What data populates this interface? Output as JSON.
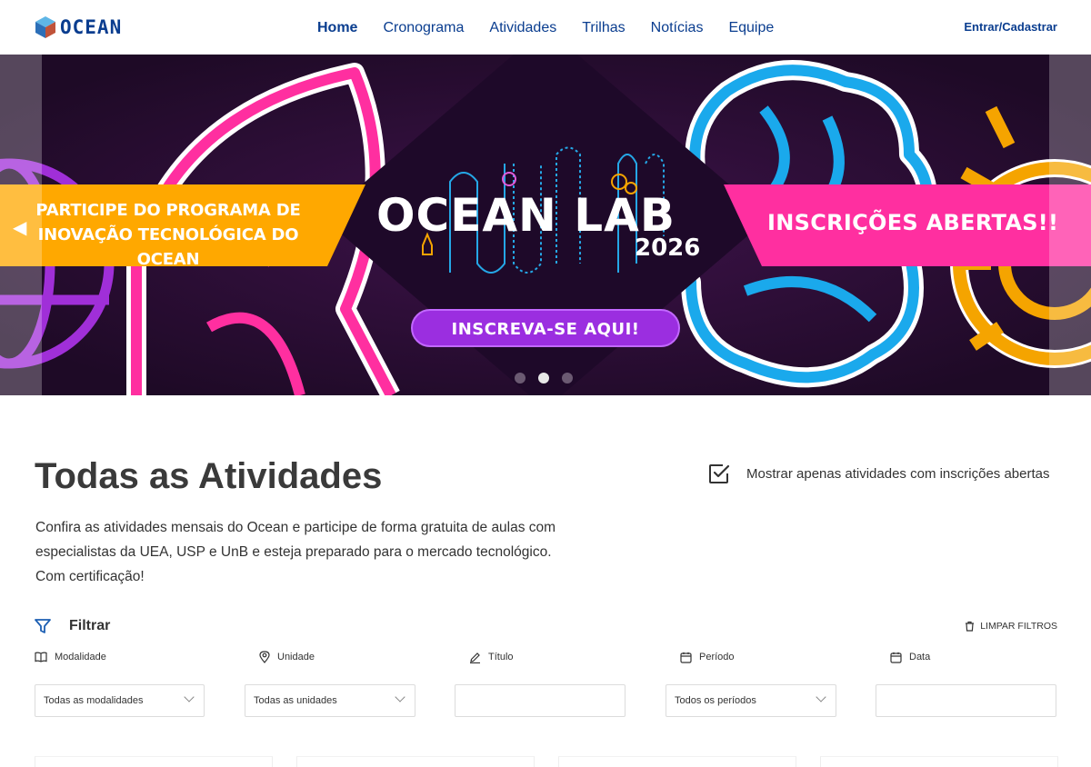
{
  "header": {
    "logo_text": "OCEAN",
    "nav": [
      {
        "label": "Home",
        "active": true
      },
      {
        "label": "Cronograma",
        "active": false
      },
      {
        "label": "Atividades",
        "active": false
      },
      {
        "label": "Trilhas",
        "active": false
      },
      {
        "label": "Notícias",
        "active": false
      },
      {
        "label": "Equipe",
        "active": false
      }
    ],
    "login_label": "Entrar/Cadastrar"
  },
  "banner": {
    "left_text": "PARTICIPE DO PROGRAMA DE INOVAÇÃO TECNOLÓGICA DO OCEAN",
    "title": "OCEAN LAB",
    "year": "2026",
    "right_text": "INSCRIÇÕES ABERTAS!!",
    "cta": "INSCREVA-SE AQUI!",
    "slide_count": 3,
    "active_slide": 2,
    "colors": {
      "orange": "#ffa800",
      "pink": "#ff2fa0",
      "purple": "#9b2ee0",
      "blue": "#1aa9ec",
      "background": "#2a0f34"
    }
  },
  "activities": {
    "title": "Todas as Atividades",
    "description": "Confira as atividades mensais do Ocean e participe de forma gratuita de aulas com especialistas da UEA, USP e UnB e esteja preparado para o mercado tecnológico. Com certificação!",
    "open_only_label": "Mostrar apenas atividades com inscrições abertas",
    "open_only_checked": true
  },
  "filters": {
    "title": "Filtrar",
    "clear_label": "LIMPAR FILTROS",
    "modalidade": {
      "label": "Modalidade",
      "value": "Todas as modalidades",
      "icon": "book-icon"
    },
    "unidade": {
      "label": "Unidade",
      "value": "Todas as unidades",
      "icon": "location-pin-icon"
    },
    "titulo": {
      "label": "Título",
      "value": "",
      "icon": "pencil-icon"
    },
    "periodo": {
      "label": "Período",
      "value": "Todos os períodos",
      "icon": "calendar-icon"
    },
    "data": {
      "label": "Data",
      "value": "",
      "icon": "calendar-icon"
    }
  }
}
